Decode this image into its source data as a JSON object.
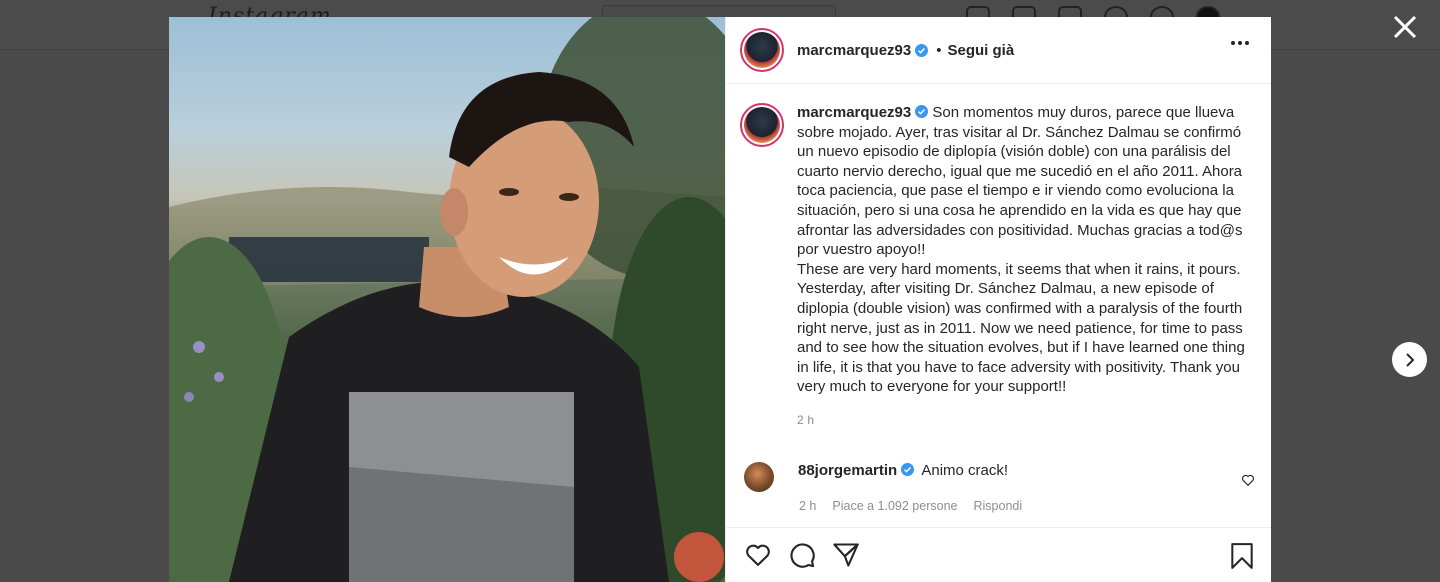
{
  "background": {
    "logo": "Instagram"
  },
  "post": {
    "username": "marcmarquez93",
    "follow_status": "Segui già",
    "caption_es": "Son momentos muy duros, parece que llueva sobre mojado. Ayer, tras visitar al Dr. Sánchez Dalmau se confirmó un nuevo episodio de diplopía (visión doble) con una parálisis del cuarto nervio derecho, igual que me sucedió en el año 2011. Ahora toca paciencia, que pase el tiempo e ir viendo como evoluciona la situación, pero si una cosa he aprendido en la vida es que hay que afrontar las adversidades con positividad. Muchas gracias a tod@s por vuestro apoyo!!",
    "caption_en": "These are very hard moments, it seems that when it rains, it pours. Yesterday, after visiting Dr. Sánchez Dalmau, a new episode of diplopia (double vision) was confirmed with a paralysis of the fourth right nerve, just as in 2011. Now we need patience, for time to pass and to see how the situation evolves, but if I have learned one thing in life, it is that you have to face adversity with positivity. Thank you very much to everyone for your support!!",
    "time": "2 h"
  },
  "comment": {
    "username": "88jorgemartin",
    "text": "Animo crack!",
    "time": "2 h",
    "likes": "Piace a 1.092 persone",
    "reply": "Rispondi"
  },
  "colors": {
    "verified": "#3897f0",
    "ring": "#d6336c",
    "muted": "#8e8e8e"
  }
}
